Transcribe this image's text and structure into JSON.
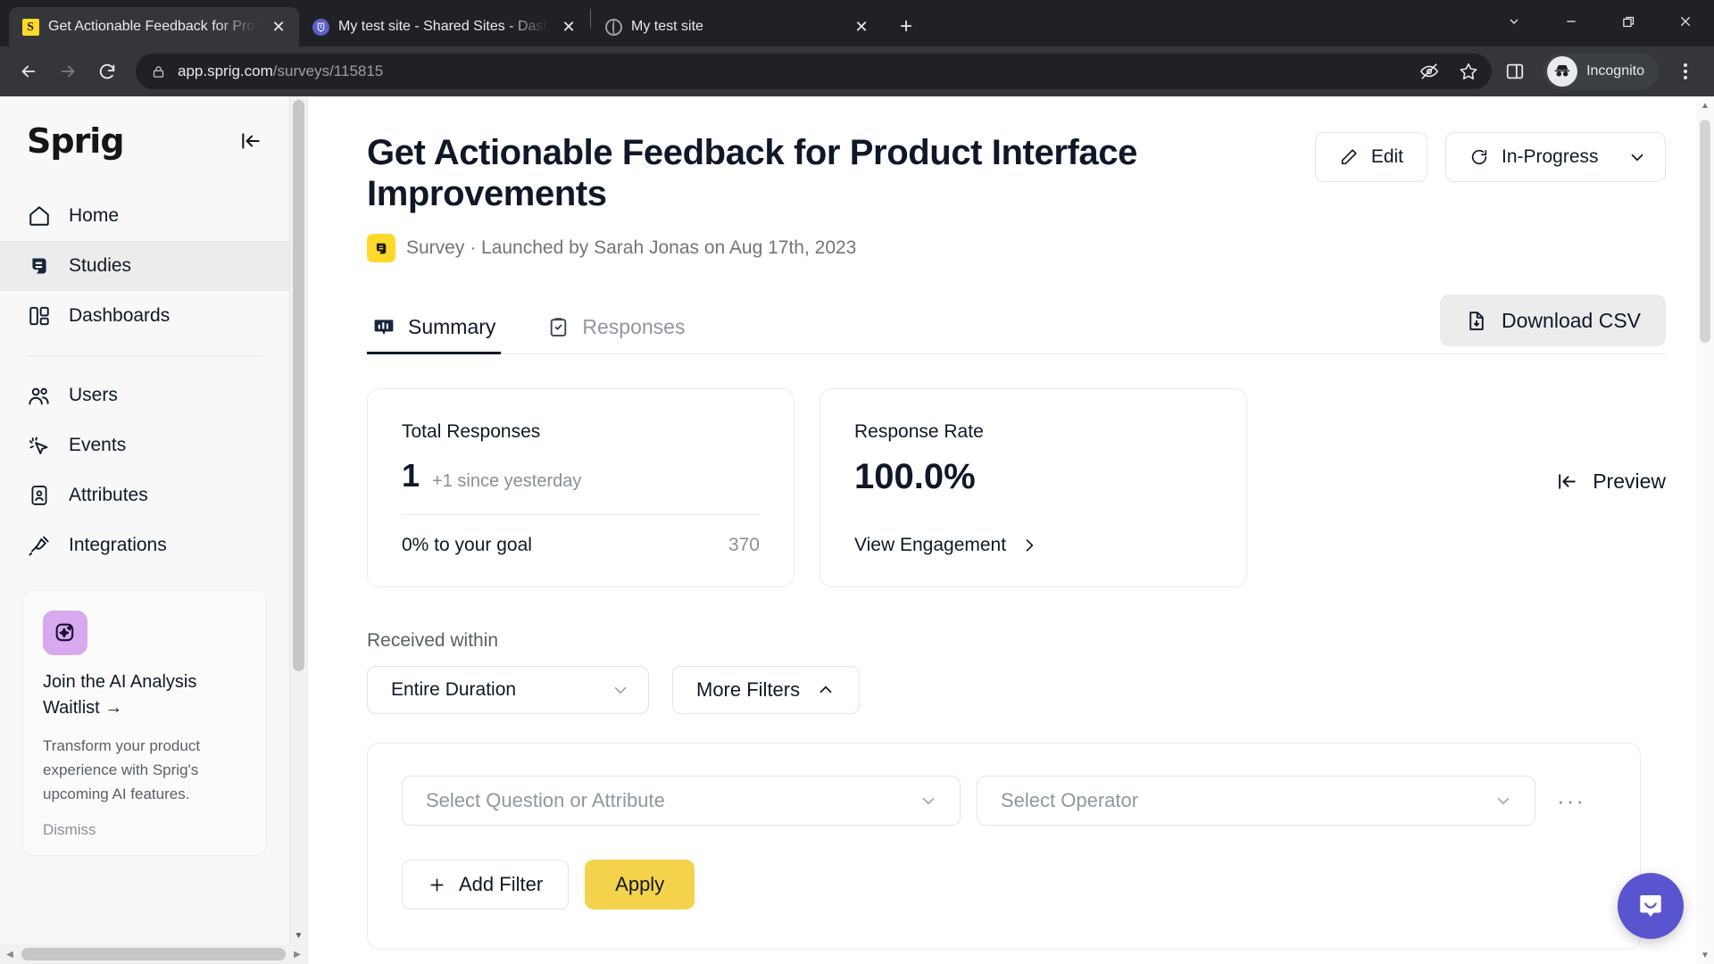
{
  "browser": {
    "tabs": [
      {
        "title": "Get Actionable Feedback for Prod",
        "favicon": "sprig-favicon",
        "active": true,
        "close_label": "✕"
      },
      {
        "title": "My test site - Shared Sites - Dash",
        "favicon": "wordpress-favicon",
        "active": false,
        "close_label": "✕"
      },
      {
        "title": "My test site",
        "favicon": "globe-favicon",
        "active": false,
        "close_label": "✕"
      }
    ],
    "new_tab_label": "+",
    "window_controls": [
      "chevron-down-icon",
      "minimize-icon",
      "maximize-icon",
      "close-icon"
    ],
    "omnibox": {
      "host": "app.sprig.com",
      "path": "/surveys/115815",
      "lock_icon": "lock-icon"
    },
    "toolbar_icons": [
      "back-icon",
      "forward-icon",
      "reload-icon",
      "tracking-protection-icon",
      "bookmark-star-icon",
      "side-panel-icon"
    ],
    "profile_chip": {
      "label": "Incognito",
      "icon": "incognito-icon"
    },
    "menu_icon": "three-dot-menu-icon"
  },
  "sidebar": {
    "logo": "Sprig",
    "collapse_icon": "collapse-sidebar-icon",
    "items": [
      {
        "label": "Home",
        "icon": "home-icon",
        "active": false
      },
      {
        "label": "Studies",
        "icon": "studies-icon",
        "active": true
      },
      {
        "label": "Dashboards",
        "icon": "dashboards-icon",
        "active": false
      },
      {
        "label": "Users",
        "icon": "users-icon",
        "active": false
      },
      {
        "label": "Events",
        "icon": "events-cursor-icon",
        "active": false
      },
      {
        "label": "Attributes",
        "icon": "attributes-id-icon",
        "active": false
      },
      {
        "label": "Integrations",
        "icon": "integrations-plug-icon",
        "active": false
      }
    ],
    "promo": {
      "icon": "ai-sparkle-icon",
      "title": "Join the AI Analysis Waitlist →",
      "body": "Transform your product experience with Sprig's upcoming AI features.",
      "dismiss_label": "Dismiss"
    }
  },
  "header": {
    "title": "Get Actionable Feedback for Product Interface Improvements",
    "edit_label": "Edit",
    "edit_icon": "pencil-icon",
    "status_label": "In-Progress",
    "status_icon": "in-progress-spinner-icon",
    "status_chevron": "chevron-down-icon",
    "badge_icon": "survey-badge-icon",
    "subtitle": "Survey · Launched by Sarah Jonas on Aug 17th, 2023"
  },
  "tabs": {
    "items": [
      {
        "label": "Summary",
        "icon": "chart-board-icon",
        "active": true
      },
      {
        "label": "Responses",
        "icon": "clipboard-check-icon",
        "active": false
      }
    ],
    "download_csv": {
      "label": "Download CSV",
      "icon": "file-download-icon"
    }
  },
  "cards": {
    "total_responses": {
      "label": "Total Responses",
      "value": "1",
      "delta": "+1 since yesterday",
      "goal_label": "0% to your goal",
      "goal_value": "370"
    },
    "response_rate": {
      "label": "Response Rate",
      "value": "100.0%",
      "link_label": "View Engagement",
      "link_icon": "chevron-right-icon"
    },
    "preview": {
      "label": "Preview",
      "icon": "preview-collapse-icon"
    }
  },
  "filters": {
    "received_within_label": "Received within",
    "duration_value": "Entire Duration",
    "duration_chevron": "chevron-down-icon",
    "more_filters_label": "More Filters",
    "more_filters_chevron": "chevron-up-icon",
    "question_placeholder": "Select Question or Attribute",
    "operator_placeholder": "Select Operator",
    "overflow_label": "···",
    "add_filter_label": "Add Filter",
    "add_filter_icon": "plus-icon",
    "apply_label": "Apply",
    "apply_color": "#f4d24b"
  },
  "widgets": {
    "intercom": {
      "icon": "intercom-chat-icon",
      "color": "#5a54cf"
    }
  }
}
